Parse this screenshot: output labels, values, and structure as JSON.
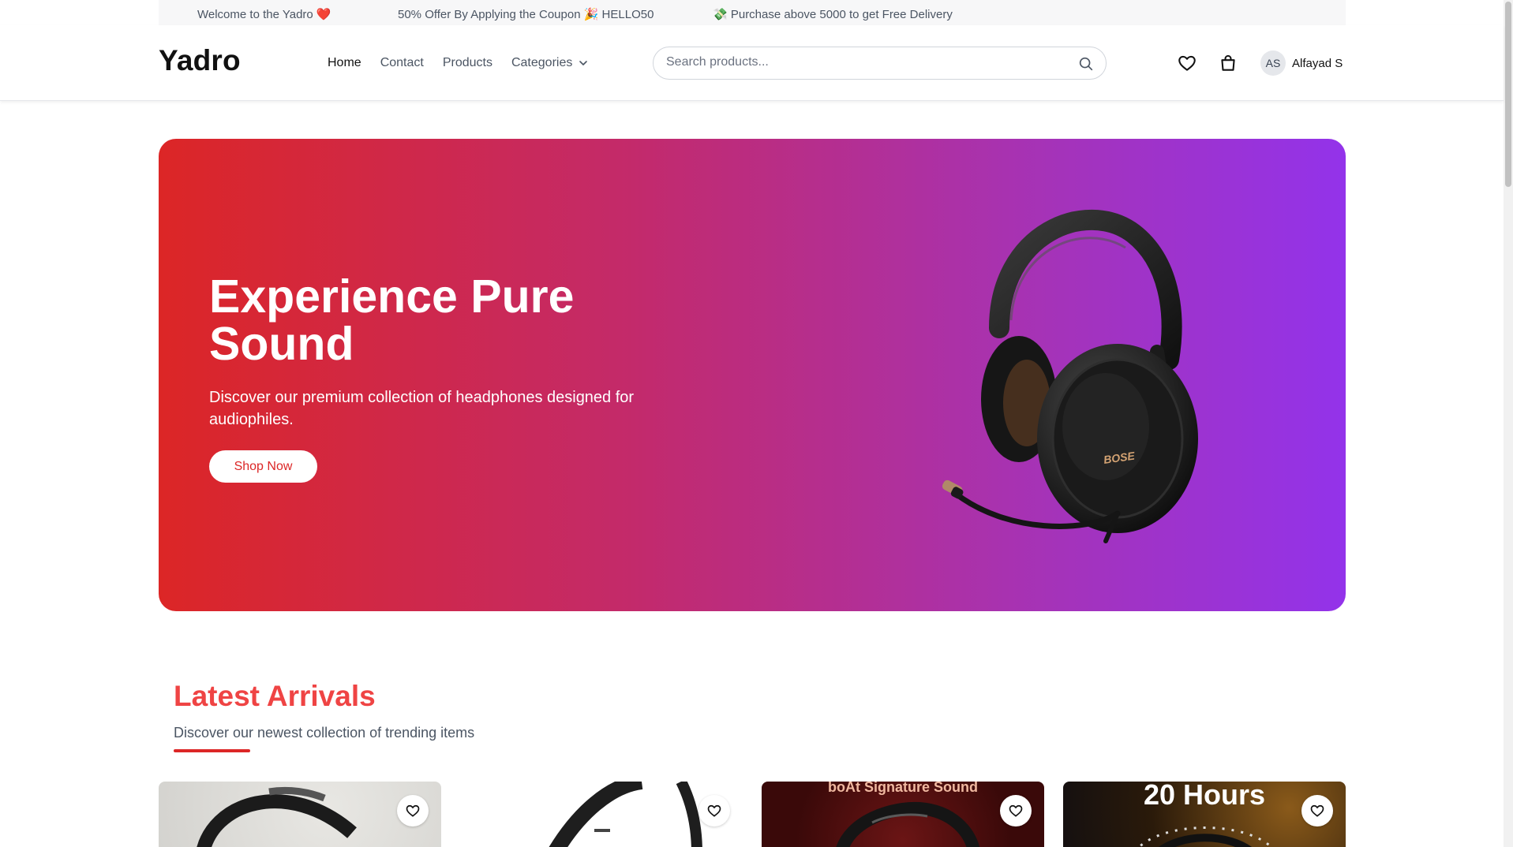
{
  "announcement": {
    "welcome": "Welcome to the Yadro ❤️",
    "offer": "50% Offer By Applying the Coupon 🎉 HELLO50",
    "delivery": "💸 Purchase above 5000 to get Free Delivery"
  },
  "header": {
    "logo": "Yadro",
    "nav": {
      "home": "Home",
      "contact": "Contact",
      "products": "Products",
      "categories": "Categories"
    },
    "search": {
      "placeholder": "Search products..."
    },
    "user": {
      "initials": "AS",
      "name": "Alfayad S"
    },
    "icons": [
      "heart-icon",
      "shopping-bag-icon",
      "search-icon",
      "chevron-down-icon"
    ]
  },
  "hero": {
    "title": "Experience Pure Sound",
    "description": "Discover our premium collection of headphones designed for audiophiles.",
    "cta": "Shop Now",
    "image_brand": "BOSE",
    "gradient": [
      "#dc2626",
      "#9333ea"
    ]
  },
  "latest": {
    "title": "Latest Arrivals",
    "subtitle": "Discover our newest collection of trending items",
    "accent": "#ef4444",
    "cards": [
      {
        "banner": ""
      },
      {
        "banner": ""
      },
      {
        "banner": "boAt Signature Sound"
      },
      {
        "banner": "20 Hours"
      }
    ]
  }
}
